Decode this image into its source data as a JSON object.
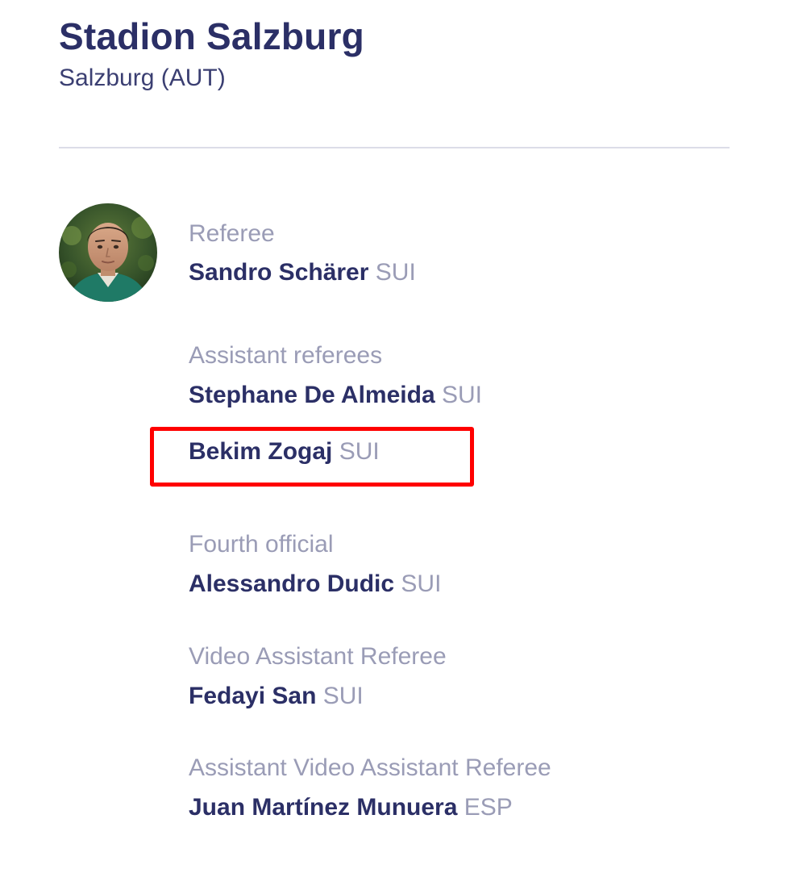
{
  "venue": {
    "name": "Stadion Salzburg",
    "city": "Salzburg (AUT)"
  },
  "officials": {
    "referee": {
      "role_label": "Referee",
      "name": "Sandro Schärer",
      "nat": "SUI"
    },
    "assistant_referees": {
      "role_label": "Assistant referees",
      "people": [
        {
          "name": "Stephane De Almeida",
          "nat": "SUI"
        },
        {
          "name": "Bekim Zogaj",
          "nat": "SUI"
        }
      ]
    },
    "fourth_official": {
      "role_label": "Fourth official",
      "name": "Alessandro Dudic",
      "nat": "SUI"
    },
    "var": {
      "role_label": "Video Assistant Referee",
      "name": "Fedayi San",
      "nat": "SUI"
    },
    "avar": {
      "role_label": "Assistant Video Assistant Referee",
      "name": "Juan Martínez Munuera",
      "nat": "ESP"
    }
  },
  "colors": {
    "title": "#2b2f66",
    "muted": "#9a9cb6",
    "divider": "#dcdde8",
    "highlight": "#ff0000"
  },
  "icons": {
    "avatar": "referee-photo"
  }
}
